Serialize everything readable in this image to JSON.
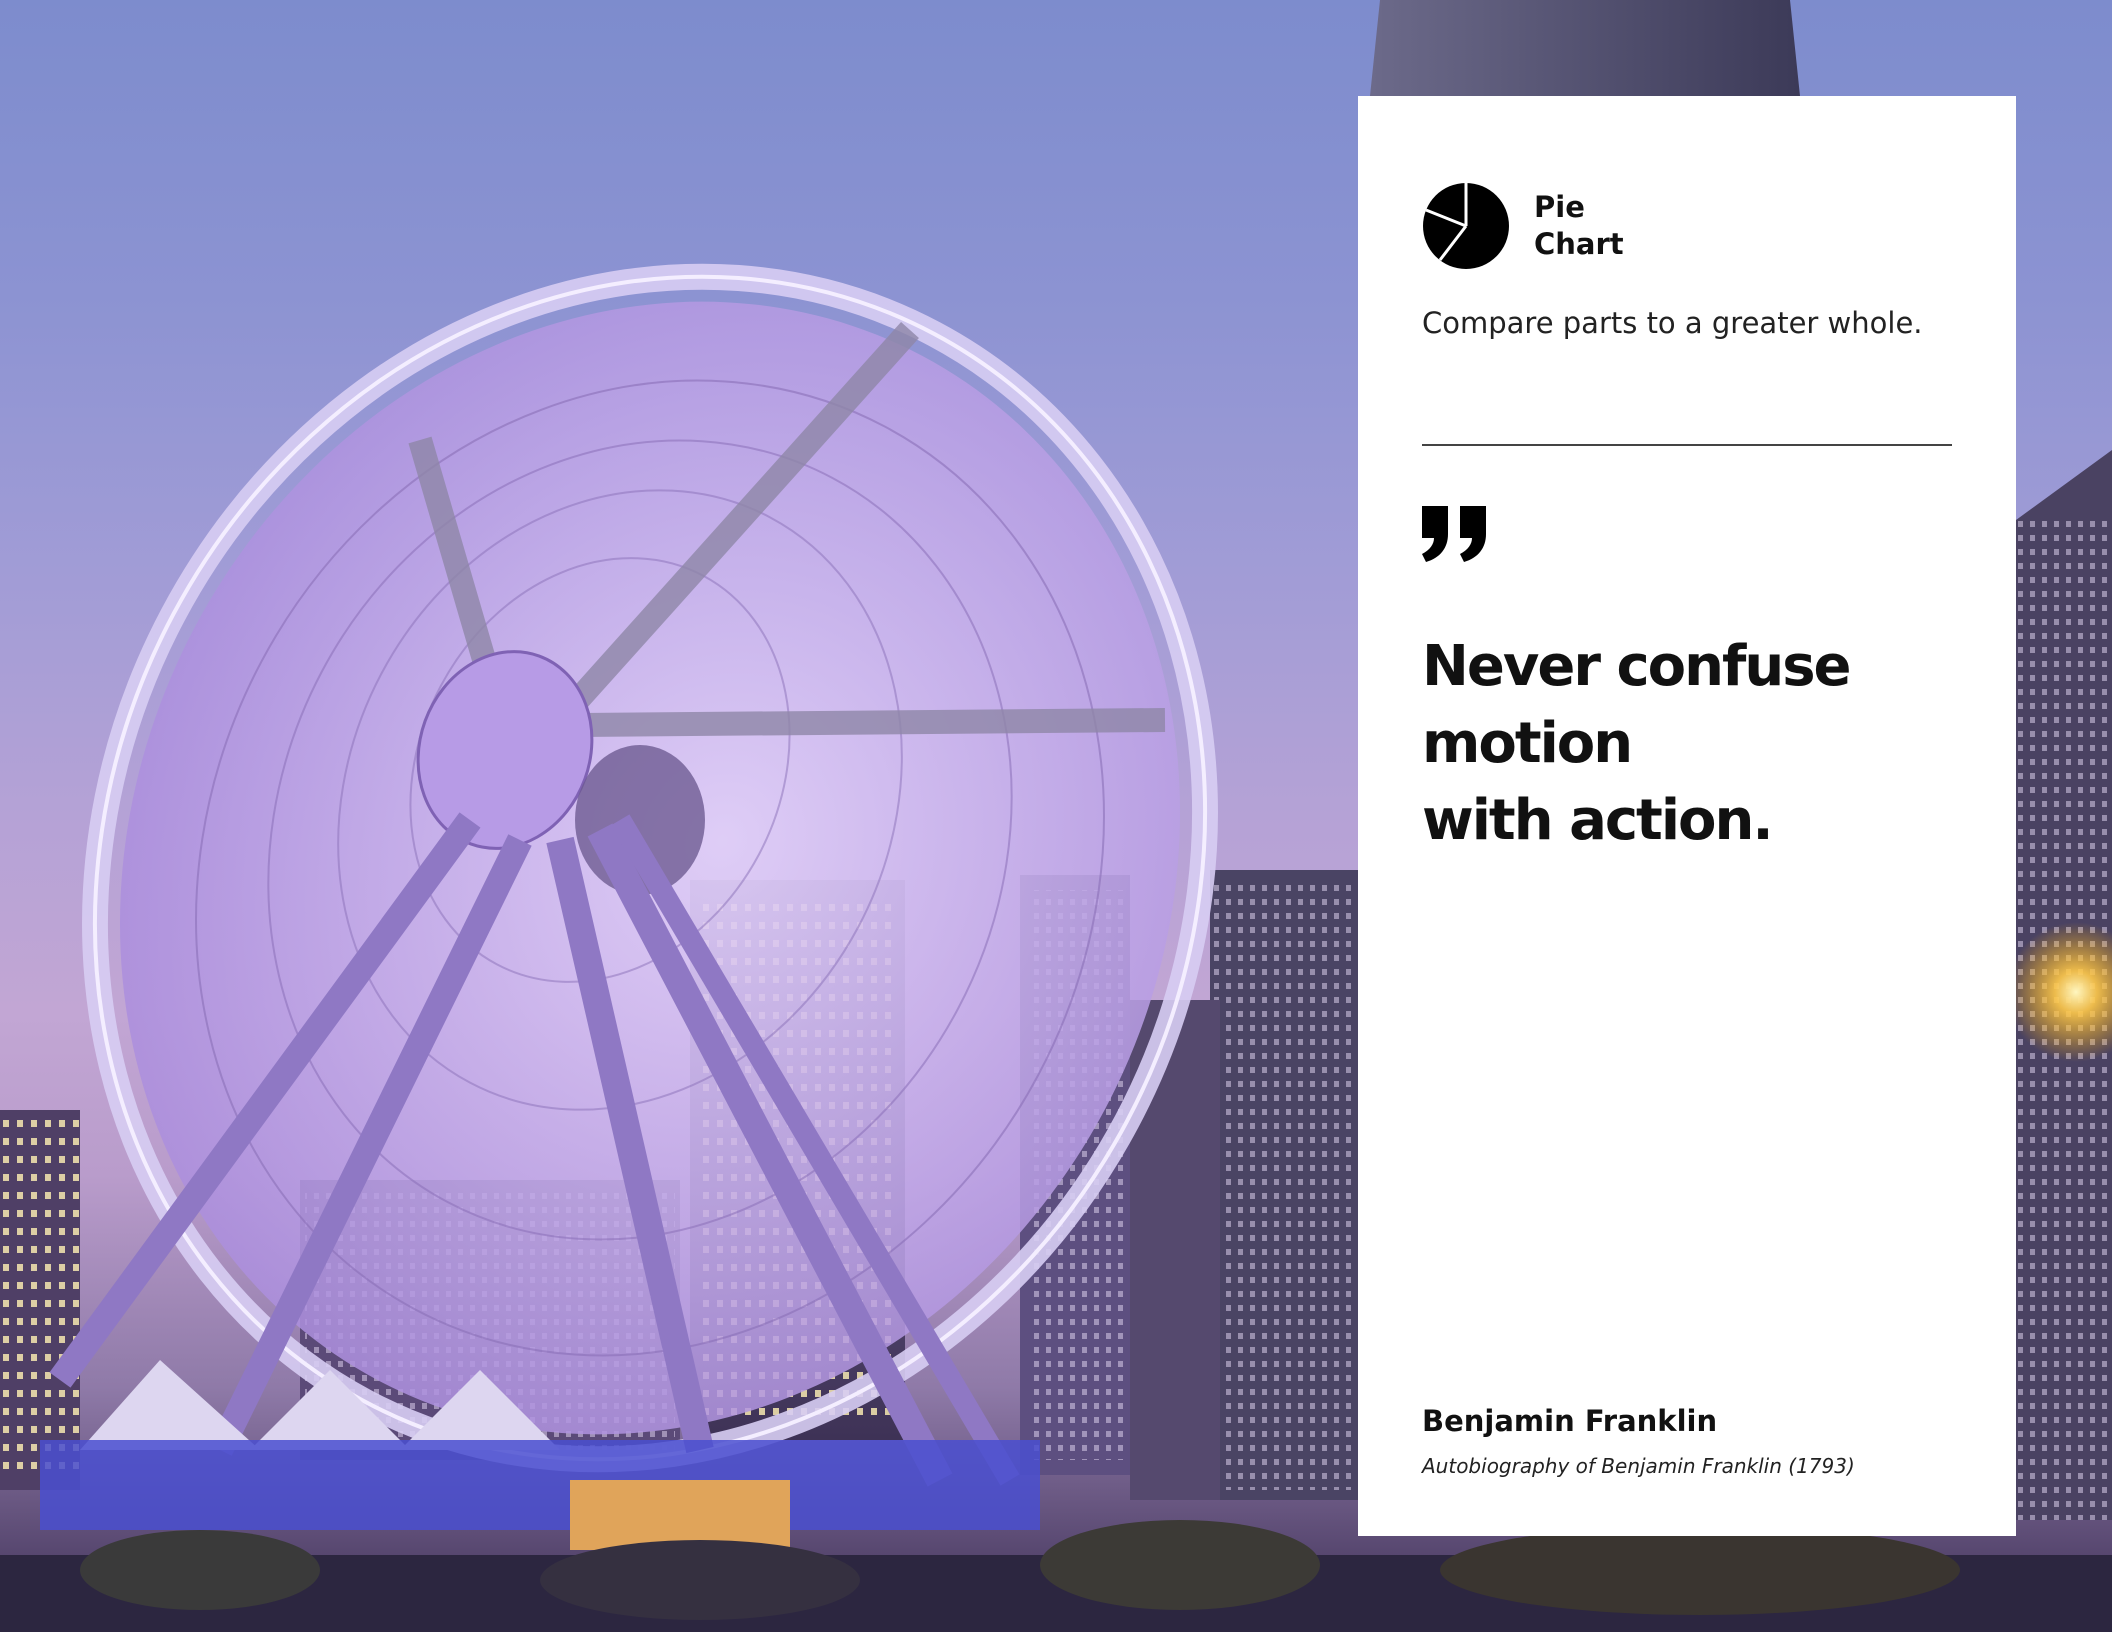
{
  "card": {
    "title_line1": "Pie",
    "title_line2": "Chart",
    "description": "Compare parts to a greater whole.",
    "quote_lines": [
      "Never confuse",
      "motion",
      "with action."
    ],
    "author": "Benjamin Franklin",
    "source": "Autobiography of Benjamin Franklin (1793)"
  },
  "icons": {
    "chart": "pie-chart-icon",
    "quote": "quotation-mark-icon"
  },
  "colors": {
    "card_background": "#ffffff",
    "text": "#111111",
    "sky_top": "#7d8ccd",
    "wheel_tint": "#b79be6"
  }
}
